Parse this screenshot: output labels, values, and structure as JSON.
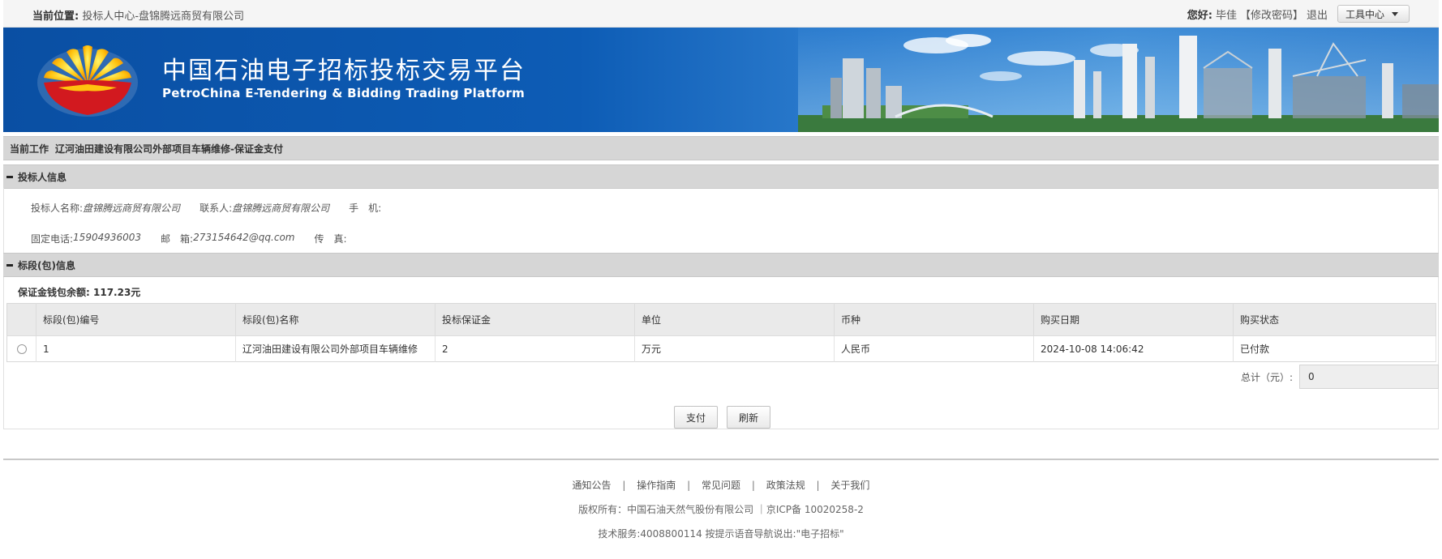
{
  "topbar": {
    "location_label": "当前位置:",
    "location": "投标人中心-盘锦腾远商贸有限公司",
    "greeting_label": "您好:",
    "user_name": "毕佳",
    "change_password": "【修改密码】",
    "logout": "退出",
    "tool_center": "工具中心"
  },
  "banner": {
    "title_cn": "中国石油电子招标投标交易平台",
    "title_en": "PetroChina E-Tendering & Bidding Trading Platform"
  },
  "current_work": {
    "label": "当前工作",
    "value": "辽河油田建设有限公司外部项目车辆维修-保证金支付"
  },
  "bidder_info": {
    "title": "投标人信息",
    "name_label": "投标人名称:",
    "name": "盘锦腾远商贸有限公司",
    "contact_label": "联系人:",
    "contact": "盘锦腾远商贸有限公司",
    "mobile_label": "手　机:",
    "mobile": "",
    "phone_label": "固定电话:",
    "phone": "15904936003",
    "email_label": "邮　箱:",
    "email": "273154642@qq.com",
    "fax_label": "传　真:",
    "fax": ""
  },
  "section_info": {
    "title": "标段(包)信息",
    "balance_label": "保证金钱包余额:",
    "balance": "117.23元",
    "columns": [
      "标段(包)编号",
      "标段(包)名称",
      "投标保证金",
      "单位",
      "币种",
      "购买日期",
      "购买状态"
    ],
    "rows": [
      {
        "no": "1",
        "name": "辽河油田建设有限公司外部项目车辆维修",
        "deposit": "2",
        "unit": "万元",
        "currency": "人民币",
        "date": "2024-10-08 14:06:42",
        "status": "已付款"
      }
    ],
    "total_label": "总计（元）:",
    "total_value": "0",
    "pay_button": "支付",
    "refresh_button": "刷新"
  },
  "footer": {
    "links": [
      "通知公告",
      "操作指南",
      "常见问题",
      "政策法规",
      "关于我们"
    ],
    "copyright": "版权所有：中国石油天然气股份有限公司 ｜京ICP备 10020258-2",
    "tech": "技术服务:4008800114 按提示语音导航说出:\"电子招标\""
  },
  "colors": {
    "banner_blue": "#0d5cb5",
    "logo_red": "#d2191f",
    "logo_yellow": "#ffc20e"
  }
}
